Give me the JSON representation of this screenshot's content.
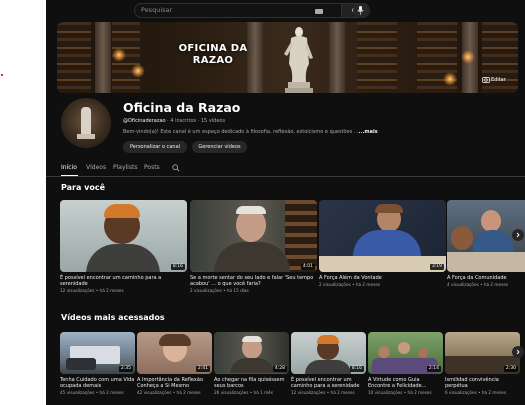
{
  "search": {
    "placeholder": "Pesquisar"
  },
  "banner": {
    "title_line1": "OFICINA DA",
    "title_line2": "RAZAO",
    "edit_label": "Editar"
  },
  "channel": {
    "name": "Oficina da Razao",
    "handle": "@Oficinaderazao",
    "stats": "· 4 inscritos · 15 vídeos",
    "description": "Bem-vindo(a)! Este canal é um espaço dedicado à filosofia, reflexão, estoicismo e questões ...",
    "more": "...mais",
    "customize_label": "Personalizar o canal",
    "manage_label": "Gerenciar vídeos"
  },
  "tabs": [
    "Início",
    "Vídeos",
    "Playlists",
    "Posts"
  ],
  "sections": {
    "for_you": "Para você",
    "most_watched": "Vídeos mais acessados"
  },
  "for_you_videos": [
    {
      "title": "É possível encontrar um caminho para a serenidade",
      "meta": "12 visualizações • há 2 meses",
      "duration": "8:16"
    },
    {
      "title": "Se a morte sentar do seu lado e falar 'Seu tempo acabou' ... o que você faria?",
      "meta": "2 visualizações • há 15 dias",
      "duration": "4:01"
    },
    {
      "title": "A Força Além da Vontade",
      "meta": "2 visualizações • há 2 meses",
      "duration": "3:19"
    },
    {
      "title": "A Força da Comunidade",
      "meta": "4 visualizações • há 2 meses",
      "duration": ""
    }
  ],
  "most_watched_videos": [
    {
      "title": "Tenha Cuidado com uma Vida ocupada demais",
      "meta": "45 visualizações • há 2 meses",
      "duration": "2:35"
    },
    {
      "title": "A Importância da Reflexão Conheça a Si Mesmo",
      "meta": "42 visualizações • há 2 meses",
      "duration": "2:41"
    },
    {
      "title": "Ao chegar na fila quiséssem seus barcos",
      "meta": "26 visualizações • há 1 mês",
      "duration": "4:28"
    },
    {
      "title": "É possível encontrar um caminho para a serenidade",
      "meta": "12 visualizações • há 2 meses",
      "duration": "8:16"
    },
    {
      "title": "A Virtude como Guia Encontre a Felicidade...",
      "meta": "10 visualizações • há 2 meses",
      "duration": "2:14"
    },
    {
      "title": "Ismilidad convivência perpétua",
      "meta": "6 visualizações • há 2 meses",
      "duration": "2:30"
    }
  ],
  "colors": {
    "background": "#0f0f0f",
    "progress": "#ff0000"
  }
}
